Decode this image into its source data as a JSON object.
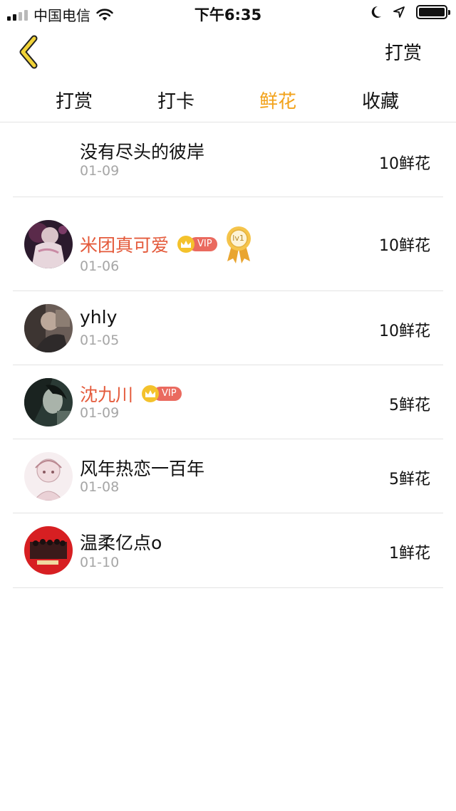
{
  "status_bar": {
    "carrier": "中国电信",
    "time": "下午6:35"
  },
  "nav": {
    "action_label": "打赏"
  },
  "tabs": [
    {
      "label": "打赏",
      "active": false
    },
    {
      "label": "打卡",
      "active": false
    },
    {
      "label": "鲜花",
      "active": true
    },
    {
      "label": "收藏",
      "active": false
    }
  ],
  "rows": [
    {
      "name": "没有尽头的彼岸",
      "date": "01-09",
      "amount": "10鲜花",
      "vip": false,
      "has_avatar": false
    },
    {
      "name": "米团真可爱",
      "date": "01-06",
      "amount": "10鲜花",
      "vip": true,
      "vip_label": "VIP",
      "level_label": "lv1",
      "has_avatar": true
    },
    {
      "name": "yhly",
      "date": "01-05",
      "amount": "10鲜花",
      "vip": false,
      "has_avatar": true
    },
    {
      "name": "沈九川",
      "date": "01-09",
      "amount": "5鲜花",
      "vip": true,
      "vip_label": "VIP",
      "has_avatar": true
    },
    {
      "name": "风年热恋一百年",
      "date": "01-08",
      "amount": "5鲜花",
      "vip": false,
      "has_avatar": true
    },
    {
      "name": "温柔亿点o",
      "date": "01-10",
      "amount": "1鲜花",
      "vip": false,
      "has_avatar": true
    }
  ],
  "colors": {
    "accent": "#f2a21a",
    "vip_name": "#e45a3b",
    "vip_pill": "#ea6a5f",
    "crown": "#f4c22c",
    "muted": "#a6a6a6",
    "divider": "#e3e3e3"
  },
  "icons": {
    "back": "chevron-left-icon",
    "wifi": "wifi-icon",
    "moon": "moon-icon",
    "location": "location-arrow-icon",
    "battery": "battery-icon",
    "crown": "crown-icon",
    "medal": "medal-icon"
  }
}
